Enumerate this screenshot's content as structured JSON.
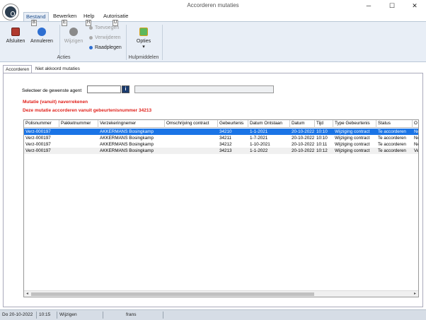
{
  "window": {
    "title": "Accorderen mutaties",
    "minimize": "─",
    "maximize": "☐",
    "close": "✕"
  },
  "menu": {
    "tabs": [
      {
        "label": "Bestand",
        "keytip": "B"
      },
      {
        "label": "Bewerken",
        "keytip": "E"
      },
      {
        "label": "Help",
        "keytip": "H"
      },
      {
        "label": "Autorisatie",
        "keytip": "U"
      }
    ]
  },
  "ribbon": {
    "afsluiten": "Afsluiten",
    "annuleren": "Annuleren",
    "wijzigen": "Wijzigen",
    "toevoegen": "Toevoegen",
    "verwijderen": "Verwijderen",
    "raadplegen": "Raadplegen",
    "opties": "Opties",
    "opties_arrow": "▾",
    "group_acties": "Acties",
    "group_hulpmiddelen": "Hulpmiddelen"
  },
  "content_tabs": [
    "Accorderen",
    "Niet akkoord mutaties"
  ],
  "form": {
    "agent_label": "Selecteer de gewenste agent",
    "agent_value": "",
    "info_icon": "i",
    "msg1": "Mutatie (vanuit) naverrekenen",
    "msg2": "Deze mutatie accorderen vanuit gebeurtenisnummer 34213"
  },
  "grid": {
    "columns": [
      "Polisnummer",
      "Pakketnummer",
      "Verzekeringnemer",
      "Omschrijving contract",
      "Gebeurtenis",
      "Datum Ontstaan",
      "Datum",
      "Tijd",
      "Type Gebeurtenis",
      "Status",
      "O"
    ],
    "rows": [
      [
        "Verz-000197",
        "",
        "AKKERMANS Bosingkamp",
        "",
        "34210",
        "1-1-2021",
        "20-10-2022",
        "10:10",
        "Wijziging contract",
        "Te accorderen",
        "Ne"
      ],
      [
        "Verz-000197",
        "",
        "AKKERMANS Bosingkamp",
        "",
        "34211",
        "1-7-2021",
        "20-10-2022",
        "10:10",
        "Wijziging contract",
        "Te accorderen",
        "Ne"
      ],
      [
        "Verz-000197",
        "",
        "AKKERMANS Bosingkamp",
        "",
        "34212",
        "1-10-2021",
        "20-10-2022",
        "10:11",
        "Wijziging contract",
        "Te accorderen",
        "Ne"
      ],
      [
        "Verz-000197",
        "",
        "AKKERMANS Bosingkamp",
        "",
        "34213",
        "1-1-2022",
        "20-10-2022",
        "10:12",
        "Wijziging contract",
        "Te accorderen",
        "Ve"
      ]
    ],
    "scroll_left": "◂",
    "scroll_right": "▸"
  },
  "status": {
    "date": "Do 20-10-2022",
    "time": "10:15",
    "mode": "Wijzigen",
    "user": "frans"
  }
}
